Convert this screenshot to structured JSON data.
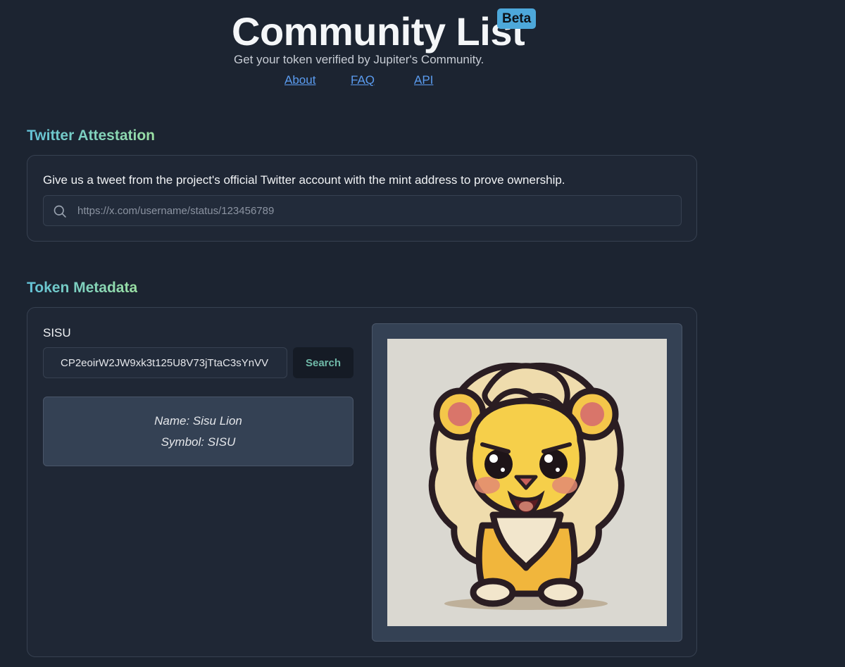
{
  "header": {
    "title": "Community List",
    "badge": "Beta",
    "subtitle": "Get your token verified by Jupiter's Community.",
    "nav": [
      {
        "label": "About"
      },
      {
        "label": "FAQ"
      },
      {
        "label": "API"
      }
    ]
  },
  "twitter": {
    "heading": "Twitter Attestation",
    "description": "Give us a tweet from the project's official Twitter account with the mint address to prove ownership.",
    "input_placeholder": "https://x.com/username/status/123456789",
    "input_value": "",
    "icon": "search-icon"
  },
  "token": {
    "heading": "Token Metadata",
    "label": "SISU",
    "mint_value": "CP2eoirW2JW9xk3t125U8V73jTtaC3sYnVV",
    "search_label": "Search",
    "name_line": "Name: Sisu Lion",
    "symbol_line": "Symbol: SISU",
    "image": "cartoon-lion-logo"
  },
  "colors": {
    "background": "#1c2431",
    "card": "#1f2735",
    "accent_link": "#5b9cf0",
    "badge": "#4da8da",
    "heading_gradient_start": "#63c2d8",
    "heading_gradient_end": "#9be0a3"
  }
}
